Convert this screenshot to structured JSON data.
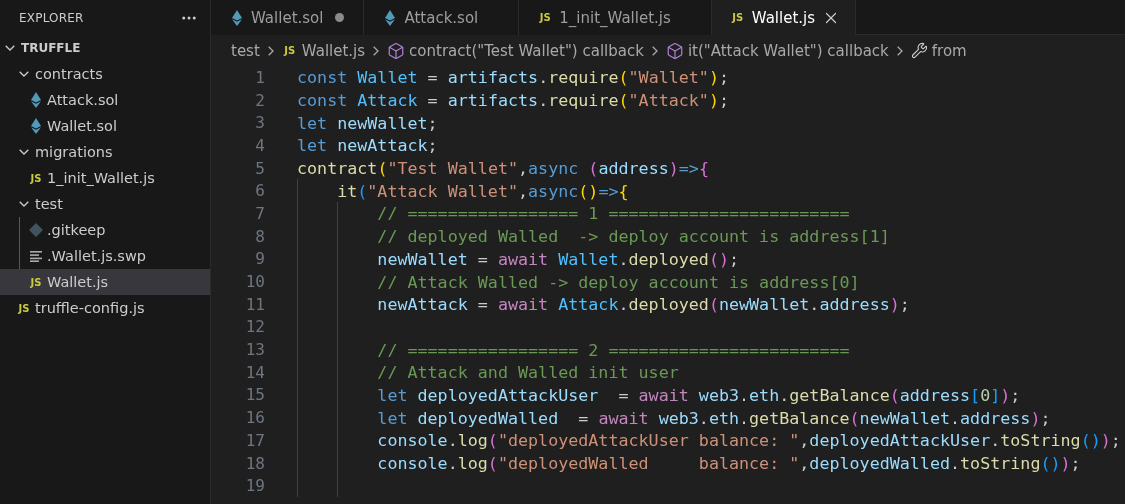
{
  "sidebar": {
    "title": "EXPLORER",
    "tree": {
      "label": "TRUFFLE",
      "kind": "root",
      "expanded": true,
      "children": [
        {
          "label": "contracts",
          "kind": "folder",
          "expanded": true,
          "children": [
            {
              "label": "Attack.sol",
              "kind": "sol",
              "selected": false
            },
            {
              "label": "Wallet.sol",
              "kind": "sol",
              "selected": false
            }
          ]
        },
        {
          "label": "migrations",
          "kind": "folder",
          "expanded": true,
          "children": [
            {
              "label": "1_init_Wallet.js",
              "kind": "js",
              "badge": "JS",
              "selected": false
            }
          ]
        },
        {
          "label": "test",
          "kind": "folder",
          "expanded": true,
          "children": [
            {
              "label": ".gitkeep",
              "kind": "git",
              "selected": false
            },
            {
              "label": ".Wallet.js.swp",
              "kind": "text",
              "selected": false
            },
            {
              "label": "Wallet.js",
              "kind": "js",
              "badge": "JS",
              "selected": true
            }
          ]
        },
        {
          "label": "truffle-config.js",
          "kind": "js",
          "badge": "JS",
          "selected": false
        }
      ]
    }
  },
  "tabs": [
    {
      "label": "Wallet.sol",
      "kind": "sol",
      "selected": false,
      "modified": true
    },
    {
      "label": "Attack.sol",
      "kind": "sol",
      "selected": false,
      "modified": false
    },
    {
      "label": "1_init_Wallet.js",
      "kind": "js",
      "badge": "JS",
      "selected": false,
      "modified": false
    },
    {
      "label": "Wallet.js",
      "kind": "js",
      "badge": "JS",
      "selected": true,
      "modified": false
    }
  ],
  "breadcrumbs": [
    {
      "label": "test",
      "kind": "folder"
    },
    {
      "label": "Wallet.js",
      "kind": "js",
      "badge": "JS"
    },
    {
      "label": "contract(\"Test Wallet\") callback",
      "kind": "symbol"
    },
    {
      "label": "it(\"Attack Wallet\") callback",
      "kind": "symbol"
    },
    {
      "label": "from",
      "kind": "wrench"
    }
  ],
  "code": [
    {
      "number": "1",
      "tokens": [
        {
          "text": "const ",
          "color": "#569cd6"
        },
        {
          "text": "Wallet",
          "color": "#4fc1ff"
        },
        {
          "text": " = "
        },
        {
          "text": "artifacts",
          "color": "#9cdcfe"
        },
        {
          "text": "."
        },
        {
          "text": "require",
          "color": "#dcdcaa"
        },
        {
          "text": "(",
          "color": "#ffd700"
        },
        {
          "text": "\"Wallet\"",
          "color": "#ce9178"
        },
        {
          "text": ")",
          "color": "#ffd700"
        },
        {
          "text": ";"
        }
      ]
    },
    {
      "number": "2",
      "tokens": [
        {
          "text": "const ",
          "color": "#569cd6"
        },
        {
          "text": "Attack",
          "color": "#4fc1ff"
        },
        {
          "text": " = "
        },
        {
          "text": "artifacts",
          "color": "#9cdcfe"
        },
        {
          "text": "."
        },
        {
          "text": "require",
          "color": "#dcdcaa"
        },
        {
          "text": "(",
          "color": "#ffd700"
        },
        {
          "text": "\"Attack\"",
          "color": "#ce9178"
        },
        {
          "text": ")",
          "color": "#ffd700"
        },
        {
          "text": ";"
        }
      ]
    },
    {
      "number": "3",
      "tokens": [
        {
          "text": "let ",
          "color": "#569cd6"
        },
        {
          "text": "newWallet",
          "color": "#9cdcfe"
        },
        {
          "text": ";"
        }
      ]
    },
    {
      "number": "4",
      "tokens": [
        {
          "text": "let ",
          "color": "#569cd6"
        },
        {
          "text": "newAttack",
          "color": "#9cdcfe"
        },
        {
          "text": ";"
        }
      ]
    },
    {
      "number": "5",
      "tokens": [
        {
          "text": "contract",
          "color": "#dcdcaa"
        },
        {
          "text": "(",
          "color": "#ffd700"
        },
        {
          "text": "\"Test Wallet\"",
          "color": "#ce9178"
        },
        {
          "text": ","
        },
        {
          "text": "async ",
          "color": "#569cd6"
        },
        {
          "text": "(",
          "color": "#da70d6"
        },
        {
          "text": "address",
          "color": "#9cdcfe"
        },
        {
          "text": ")",
          "color": "#da70d6"
        },
        {
          "text": "=>",
          "color": "#569cd6"
        },
        {
          "text": "{",
          "color": "#da70d6"
        }
      ]
    },
    {
      "number": "6",
      "tokens": [
        {
          "text": "    it",
          "color": "#dcdcaa"
        },
        {
          "text": "(",
          "color": "#179fff"
        },
        {
          "text": "\"Attack Wallet\"",
          "color": "#ce9178"
        },
        {
          "text": ","
        },
        {
          "text": "async",
          "color": "#569cd6"
        },
        {
          "text": "()",
          "color": "#ffd700"
        },
        {
          "text": "=>",
          "color": "#569cd6"
        },
        {
          "text": "{",
          "color": "#ffd700"
        }
      ]
    },
    {
      "number": "7",
      "tokens": [
        {
          "text": "        // ================= 1 ========================",
          "color": "#6a9955"
        }
      ]
    },
    {
      "number": "8",
      "tokens": [
        {
          "text": "        // deployed Walled  -> deploy account is address[1]",
          "color": "#6a9955"
        }
      ]
    },
    {
      "number": "9",
      "tokens": [
        {
          "text": "        newWallet",
          "color": "#9cdcfe"
        },
        {
          "text": " = "
        },
        {
          "text": "await ",
          "color": "#c586c0"
        },
        {
          "text": "Wallet",
          "color": "#4fc1ff"
        },
        {
          "text": "."
        },
        {
          "text": "deployed",
          "color": "#dcdcaa"
        },
        {
          "text": "()",
          "color": "#da70d6"
        },
        {
          "text": ";"
        }
      ]
    },
    {
      "number": "10",
      "tokens": [
        {
          "text": "        // Attack Walled -> deploy account is address[0]",
          "color": "#6a9955"
        }
      ]
    },
    {
      "number": "11",
      "tokens": [
        {
          "text": "        newAttack",
          "color": "#9cdcfe"
        },
        {
          "text": " = "
        },
        {
          "text": "await ",
          "color": "#c586c0"
        },
        {
          "text": "Attack",
          "color": "#4fc1ff"
        },
        {
          "text": "."
        },
        {
          "text": "deployed",
          "color": "#dcdcaa"
        },
        {
          "text": "(",
          "color": "#da70d6"
        },
        {
          "text": "newWallet",
          "color": "#9cdcfe"
        },
        {
          "text": "."
        },
        {
          "text": "address",
          "color": "#9cdcfe"
        },
        {
          "text": ")",
          "color": "#da70d6"
        },
        {
          "text": ";"
        }
      ]
    },
    {
      "number": "12"
    },
    {
      "number": "13",
      "tokens": [
        {
          "text": "        // ================= 2 ========================",
          "color": "#6a9955"
        }
      ]
    },
    {
      "number": "14",
      "tokens": [
        {
          "text": "        // Attack and Walled init user",
          "color": "#6a9955"
        }
      ]
    },
    {
      "number": "15",
      "tokens": [
        {
          "text": "        let ",
          "color": "#569cd6"
        },
        {
          "text": "deployedAttackUser",
          "color": "#9cdcfe"
        },
        {
          "text": "  = "
        },
        {
          "text": "await ",
          "color": "#c586c0"
        },
        {
          "text": "web3",
          "color": "#9cdcfe"
        },
        {
          "text": "."
        },
        {
          "text": "eth",
          "color": "#9cdcfe"
        },
        {
          "text": "."
        },
        {
          "text": "getBalance",
          "color": "#dcdcaa"
        },
        {
          "text": "(",
          "color": "#da70d6"
        },
        {
          "text": "address",
          "color": "#9cdcfe"
        },
        {
          "text": "[",
          "color": "#179fff"
        },
        {
          "text": "0",
          "color": "#b5cea8"
        },
        {
          "text": "]",
          "color": "#179fff"
        },
        {
          "text": ")",
          "color": "#da70d6"
        },
        {
          "text": ";"
        }
      ]
    },
    {
      "number": "16",
      "tokens": [
        {
          "text": "        let ",
          "color": "#569cd6"
        },
        {
          "text": "deployedWalled",
          "color": "#9cdcfe"
        },
        {
          "text": "  = "
        },
        {
          "text": "await ",
          "color": "#c586c0"
        },
        {
          "text": "web3",
          "color": "#9cdcfe"
        },
        {
          "text": "."
        },
        {
          "text": "eth",
          "color": "#9cdcfe"
        },
        {
          "text": "."
        },
        {
          "text": "getBalance",
          "color": "#dcdcaa"
        },
        {
          "text": "(",
          "color": "#da70d6"
        },
        {
          "text": "newWallet",
          "color": "#9cdcfe"
        },
        {
          "text": "."
        },
        {
          "text": "address",
          "color": "#9cdcfe"
        },
        {
          "text": ")",
          "color": "#da70d6"
        },
        {
          "text": ";"
        }
      ]
    },
    {
      "number": "17",
      "tokens": [
        {
          "text": "        console",
          "color": "#9cdcfe"
        },
        {
          "text": "."
        },
        {
          "text": "log",
          "color": "#dcdcaa"
        },
        {
          "text": "(",
          "color": "#da70d6"
        },
        {
          "text": "\"deployedAttackUser balance: \"",
          "color": "#ce9178"
        },
        {
          "text": ","
        },
        {
          "text": "deployedAttackUser",
          "color": "#9cdcfe"
        },
        {
          "text": "."
        },
        {
          "text": "toString",
          "color": "#dcdcaa"
        },
        {
          "text": "()",
          "color": "#179fff"
        },
        {
          "text": ")",
          "color": "#da70d6"
        },
        {
          "text": ";"
        }
      ]
    },
    {
      "number": "18",
      "tokens": [
        {
          "text": "        console",
          "color": "#9cdcfe"
        },
        {
          "text": "."
        },
        {
          "text": "log",
          "color": "#dcdcaa"
        },
        {
          "text": "(",
          "color": "#da70d6"
        },
        {
          "text": "\"deployedWalled     balance: \"",
          "color": "#ce9178"
        },
        {
          "text": ","
        },
        {
          "text": "deployedWalled",
          "color": "#9cdcfe"
        },
        {
          "text": "."
        },
        {
          "text": "toString",
          "color": "#dcdcaa"
        },
        {
          "text": "()",
          "color": "#179fff"
        },
        {
          "text": ")",
          "color": "#da70d6"
        },
        {
          "text": ";"
        }
      ]
    },
    {
      "number": "19"
    }
  ]
}
